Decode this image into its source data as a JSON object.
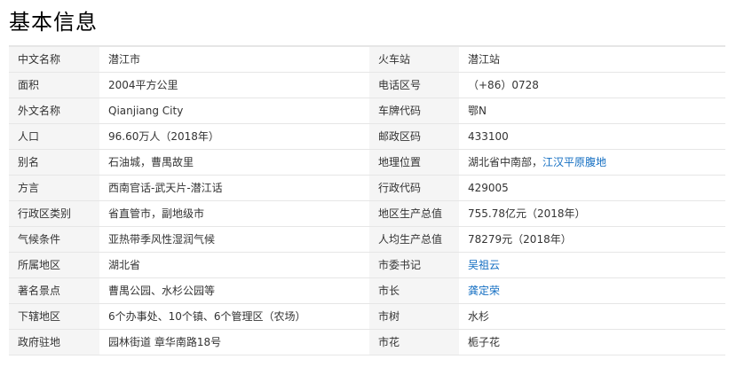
{
  "section": {
    "title": "基本信息"
  },
  "rows": [
    {
      "left_label": "中文名称",
      "left_value": "潜江市",
      "right_label": "火车站",
      "right_value": "潜江站"
    },
    {
      "left_label": "面积",
      "left_value": "2004平方公里",
      "right_label": "电话区号",
      "right_value": "（+86）0728"
    },
    {
      "left_label": "外文名称",
      "left_value": "Qianjiang City",
      "right_label": "车牌代码",
      "right_value": "鄂N"
    },
    {
      "left_label": "人口",
      "left_value": "96.60万人（2018年）",
      "right_label": "邮政区码",
      "right_value": "433100"
    },
    {
      "left_label": "别名",
      "left_value": "石油城，曹禺故里",
      "right_label": "地理位置",
      "right_value_prefix": "湖北省中南部，",
      "right_value_link": "江汉平原腹地"
    },
    {
      "left_label": "方言",
      "left_value": "西南官话-武天片-潜江话",
      "right_label": "行政代码",
      "right_value": "429005"
    },
    {
      "left_label": "行政区类别",
      "left_value": "省直管市，副地级市",
      "right_label": "地区生产总值",
      "right_value": "755.78亿元（2018年）"
    },
    {
      "left_label": "气候条件",
      "left_value": "亚热带季风性湿润气候",
      "right_label": "人均生产总值",
      "right_value": "78279元（2018年）"
    },
    {
      "left_label": "所属地区",
      "left_value": "湖北省",
      "right_label": "市委书记",
      "right_value_link": "吴祖云"
    },
    {
      "left_label": "著名景点",
      "left_value": "曹禺公园、水杉公园等",
      "right_label": "市长",
      "right_value_link": "龚定荣"
    },
    {
      "left_label": "下辖地区",
      "left_value": "6个办事处、10个镇、6个管理区（农场）",
      "right_label": "市树",
      "right_value": "水杉"
    },
    {
      "left_label": "政府驻地",
      "left_value": "园林街道 章华南路18号",
      "right_label": "市花",
      "right_value": "栀子花"
    }
  ]
}
